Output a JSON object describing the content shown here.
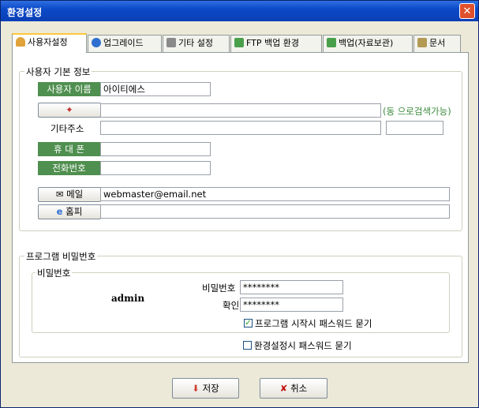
{
  "window": {
    "title": "환경설정"
  },
  "tabs": [
    {
      "label": "사용자설정",
      "icon": "user-icon",
      "color": "#e0a33a"
    },
    {
      "label": "업그레이드",
      "icon": "ie-globe-icon",
      "color": "#2e6fd0"
    },
    {
      "label": "기타 설정",
      "icon": "tools-icon",
      "color": "#7a7a7a"
    },
    {
      "label": "FTP 백업 환경",
      "icon": "server-icon",
      "color": "#4aa04a"
    },
    {
      "label": "백업(자료보관)",
      "icon": "server-icon",
      "color": "#4aa04a"
    },
    {
      "label": "문서",
      "icon": "document-icon",
      "color": "#b39a55"
    }
  ],
  "user_info": {
    "group_title": "사용자 기본 정보",
    "name_label": "사용자 이름",
    "name_value": "아이티에스",
    "address_hint": "(동 으로검색가능)",
    "other_address_label": "기타주소",
    "mobile_label": "휴 대 폰",
    "phone_label": "전화번호",
    "email_label": "메일",
    "email_value": "webmaster@email.net",
    "homepage_label": "홈피"
  },
  "password": {
    "group_title": "프로그램 비밀번호",
    "inner_title": "비밀번호",
    "user_id": "admin",
    "password_label": "비밀번호",
    "password_value": "********",
    "confirm_label": "확인",
    "confirm_value": "********",
    "ask_on_start_label": "프로그램 시작시 패스워드 묻기",
    "ask_on_start_checked": true,
    "ask_on_settings_label": "환경설정시 패스워드 묻기",
    "ask_on_settings_checked": false
  },
  "buttons": {
    "save_label": "저장",
    "cancel_label": "취소"
  },
  "colors": {
    "label_green": "#4f8f4f",
    "accent_tab": "#ffc83c"
  }
}
